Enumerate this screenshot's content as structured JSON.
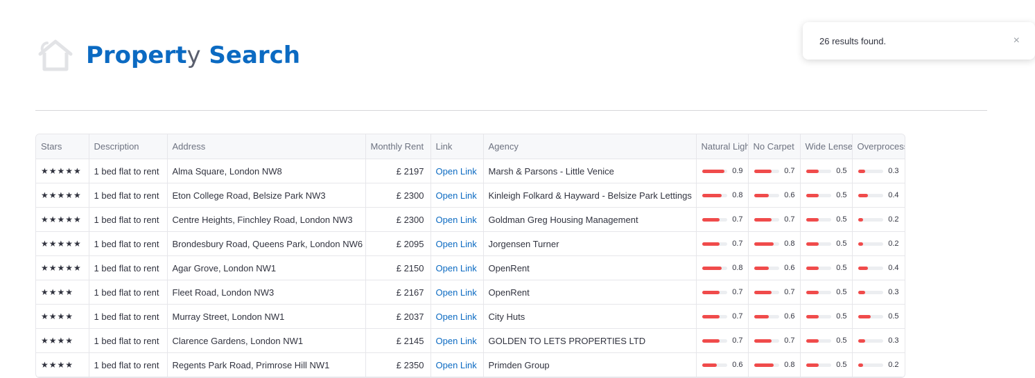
{
  "page": {
    "title_main": "Propert",
    "title_ty": "y",
    "title_end": " Search"
  },
  "toast": {
    "message": "26 results found.",
    "close_glyph": "×"
  },
  "table": {
    "headers": [
      "Stars",
      "Description",
      "Address",
      "Monthly Rent",
      "Link",
      "Agency",
      "Natural Light",
      "No Carpet",
      "Wide Lense",
      "Overprocessed"
    ],
    "link_text": "Open Link",
    "rows": [
      {
        "stars": "★★★★★",
        "description": "1 bed flat to rent",
        "address": "Alma Square, London NW8",
        "rent": "£ 2197",
        "agency": "Marsh & Parsons - Little Venice",
        "natural_light": 0.9,
        "no_carpet": 0.7,
        "wide_lense": 0.5,
        "overprocessed": 0.3
      },
      {
        "stars": "★★★★★",
        "description": "1 bed flat to rent",
        "address": "Eton College Road, Belsize Park NW3",
        "rent": "£ 2300",
        "agency": "Kinleigh Folkard & Hayward - Belsize Park Lettings",
        "natural_light": 0.8,
        "no_carpet": 0.6,
        "wide_lense": 0.5,
        "overprocessed": 0.4
      },
      {
        "stars": "★★★★★",
        "description": "1 bed flat to rent",
        "address": "Centre Heights, Finchley Road, London NW3",
        "rent": "£ 2300",
        "agency": "Goldman Greg Housing Management",
        "natural_light": 0.7,
        "no_carpet": 0.7,
        "wide_lense": 0.5,
        "overprocessed": 0.2
      },
      {
        "stars": "★★★★★",
        "description": "1 bed flat to rent",
        "address": "Brondesbury Road, Queens Park, London NW6",
        "rent": "£ 2095",
        "agency": "Jorgensen Turner",
        "natural_light": 0.7,
        "no_carpet": 0.8,
        "wide_lense": 0.5,
        "overprocessed": 0.2
      },
      {
        "stars": "★★★★★",
        "description": "1 bed flat to rent",
        "address": "Agar Grove, London NW1",
        "rent": "£ 2150",
        "agency": "OpenRent",
        "natural_light": 0.8,
        "no_carpet": 0.6,
        "wide_lense": 0.5,
        "overprocessed": 0.4
      },
      {
        "stars": "★★★★",
        "description": "1 bed flat to rent",
        "address": "Fleet Road, London NW3",
        "rent": "£ 2167",
        "agency": "OpenRent",
        "natural_light": 0.7,
        "no_carpet": 0.7,
        "wide_lense": 0.5,
        "overprocessed": 0.3
      },
      {
        "stars": "★★★★",
        "description": "1 bed flat to rent",
        "address": "Murray Street, London NW1",
        "rent": "£ 2037",
        "agency": "City Huts",
        "natural_light": 0.7,
        "no_carpet": 0.6,
        "wide_lense": 0.5,
        "overprocessed": 0.5
      },
      {
        "stars": "★★★★",
        "description": "1 bed flat to rent",
        "address": "Clarence Gardens, London NW1",
        "rent": "£ 2145",
        "agency": "GOLDEN TO LETS PROPERTIES LTD",
        "natural_light": 0.7,
        "no_carpet": 0.7,
        "wide_lense": 0.5,
        "overprocessed": 0.3
      },
      {
        "stars": "★★★★",
        "description": "1 bed flat to rent",
        "address": "Regents Park Road, Primrose Hill NW1",
        "rent": "£ 2350",
        "agency": "Primden Group",
        "natural_light": 0.6,
        "no_carpet": 0.8,
        "wide_lense": 0.5,
        "overprocessed": 0.2
      }
    ]
  },
  "colors": {
    "accent": "#0b6ac2",
    "bar": "#f04b4b"
  },
  "icons": {
    "header": "house-icon",
    "toast_close": "close-icon"
  }
}
